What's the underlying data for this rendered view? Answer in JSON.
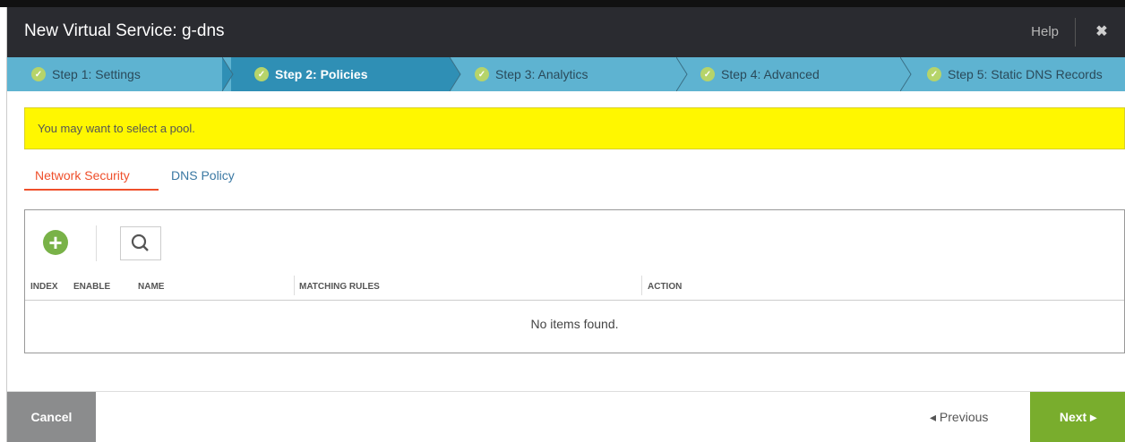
{
  "modal": {
    "title": "New Virtual Service: g-dns",
    "help_label": "Help",
    "close_glyph": "✖"
  },
  "wizard": {
    "steps": [
      {
        "label": "Step 1: Settings",
        "active": false
      },
      {
        "label": "Step 2: Policies",
        "active": true
      },
      {
        "label": "Step 3: Analytics",
        "active": false
      },
      {
        "label": "Step 4: Advanced",
        "active": false
      },
      {
        "label": "Step 5: Static DNS Records",
        "active": false
      }
    ],
    "check_glyph": "✓"
  },
  "warning": {
    "text": "You may want to select a pool."
  },
  "tabs": [
    {
      "label": "Network Security",
      "selected": true
    },
    {
      "label": "DNS Policy",
      "selected": false
    }
  ],
  "grid": {
    "add_glyph": "+",
    "columns": [
      "INDEX",
      "ENABLE",
      "NAME",
      "MATCHING RULES",
      "ACTION"
    ],
    "empty_text": "No items found."
  },
  "footer": {
    "cancel_label": "Cancel",
    "previous_label": "◂ Previous",
    "next_label": "Next ▸"
  },
  "colors": {
    "header_bg": "#2a2b30",
    "wizard_bg": "#5eb3d1",
    "wizard_active": "#2f8fb5",
    "warning_bg": "#fff700",
    "tab_active": "#ef4f2b",
    "next_bg": "#79ad2d",
    "cancel_bg": "#8b8c8d"
  }
}
